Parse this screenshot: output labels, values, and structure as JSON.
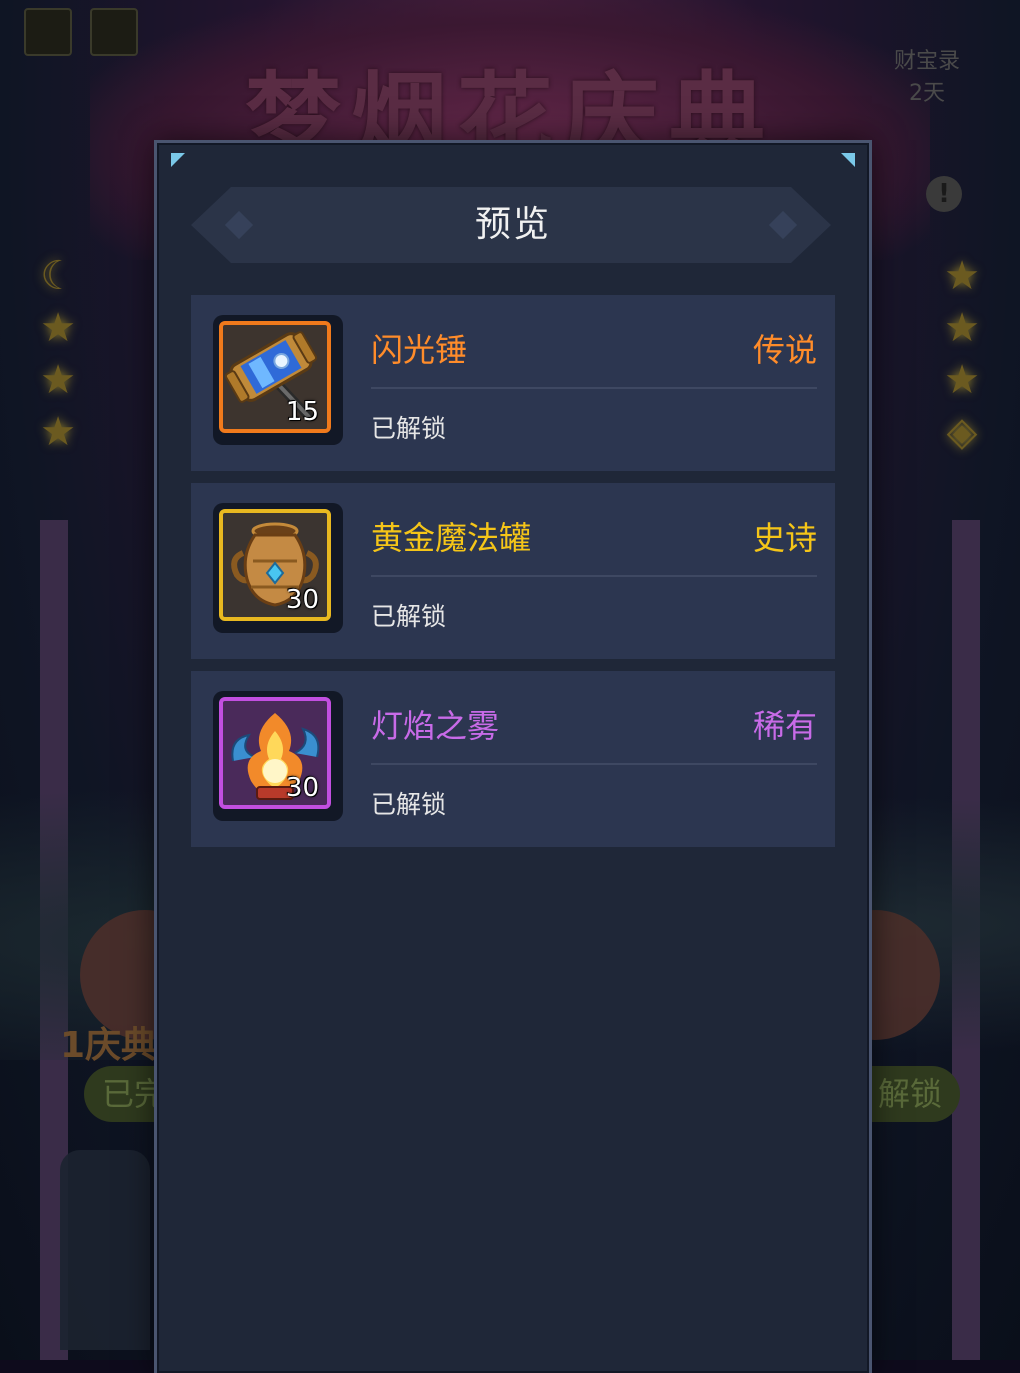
{
  "background": {
    "banner_title": "梦烟花庆典",
    "top_right_line1": "财宝录",
    "top_right_line2": "2天",
    "left_label": "1庆典",
    "left_pill": "已完成",
    "right_pill": "解锁",
    "alert": "!"
  },
  "dialog": {
    "title": "预览",
    "items": [
      {
        "name": "闪光锤",
        "rarity": "传说",
        "status": "已解锁",
        "count": "15",
        "icon": "hammer-icon",
        "color": "#ff8c2a",
        "frame_color": "#f07a1c"
      },
      {
        "name": "黄金魔法罐",
        "rarity": "史诗",
        "status": "已解锁",
        "count": "30",
        "icon": "golden-jar-icon",
        "color": "#f5c518",
        "frame_color": "#e8b820"
      },
      {
        "name": "灯焰之雾",
        "rarity": "稀有",
        "status": "已解锁",
        "count": "30",
        "icon": "flame-mist-icon",
        "color": "#c86be8",
        "frame_color": "#c24fe0"
      }
    ]
  }
}
